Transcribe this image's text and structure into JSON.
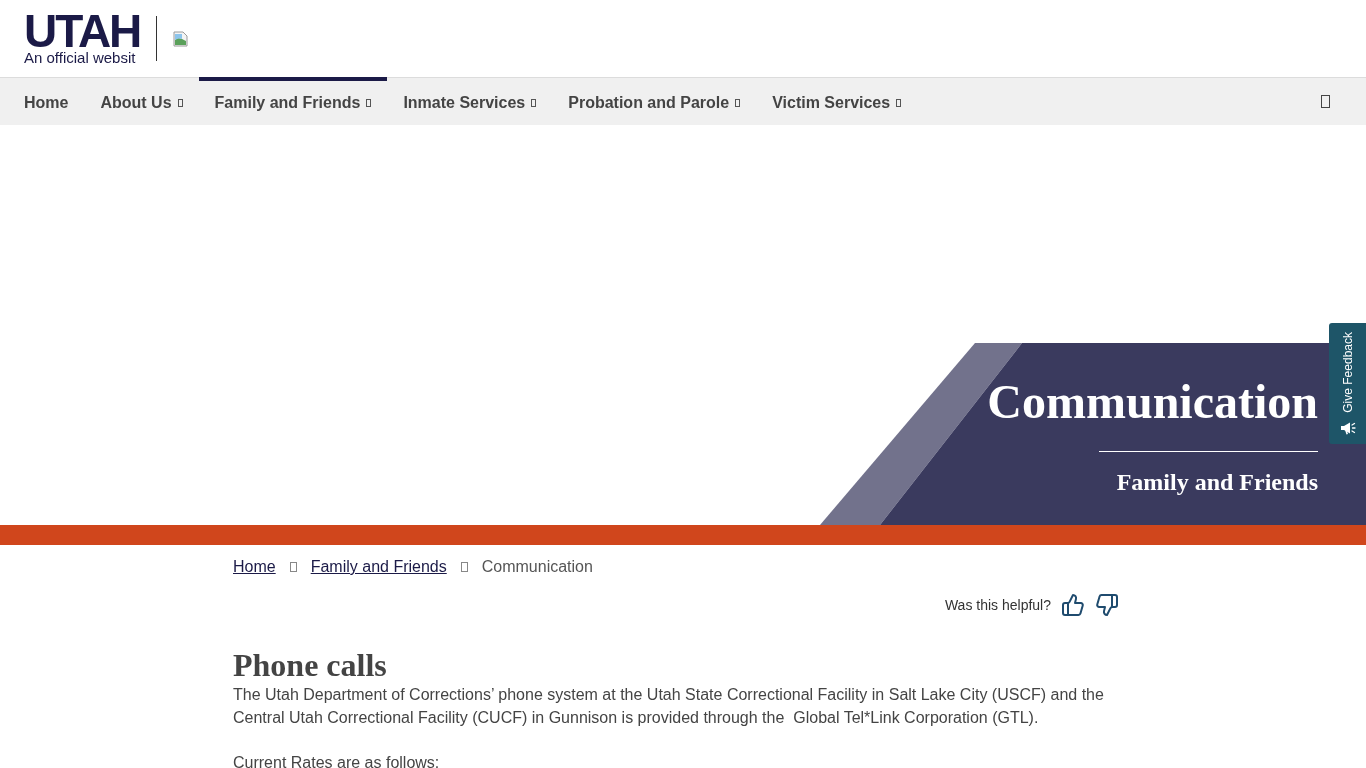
{
  "header": {
    "logo": {
      "wordmark": "UTAH",
      "tagline": "An official websit"
    }
  },
  "nav": {
    "items": [
      {
        "label": "Home",
        "has_menu": false,
        "selected": false
      },
      {
        "label": "About Us",
        "has_menu": true,
        "selected": false
      },
      {
        "label": "Family and Friends",
        "has_menu": true,
        "selected": true
      },
      {
        "label": "Inmate Services",
        "has_menu": true,
        "selected": false
      },
      {
        "label": "Probation and Parole",
        "has_menu": true,
        "selected": false
      },
      {
        "label": "Victim Services",
        "has_menu": true,
        "selected": false
      }
    ]
  },
  "hero": {
    "title": "Communication",
    "subtitle": "Family and Friends"
  },
  "feedback_tab": {
    "label": "Give Feedback"
  },
  "breadcrumb": [
    {
      "label": "Home",
      "kind": "link"
    },
    {
      "label": "Family and Friends",
      "kind": "link"
    },
    {
      "label": "Communication",
      "kind": "current"
    }
  ],
  "helpful": {
    "question": "Was this helpful?"
  },
  "content": {
    "heading": "Phone calls",
    "paragraphs": [
      "The Utah Department of Corrections’ phone system at the Utah State Correctional Facility in Salt Lake City (USCF) and the Central Utah Correctional Facility (CUCF) in Gunnison is provided through the  Global Tel*Link Corporation (GTL).",
      "Current Rates are as follows:"
    ]
  }
}
